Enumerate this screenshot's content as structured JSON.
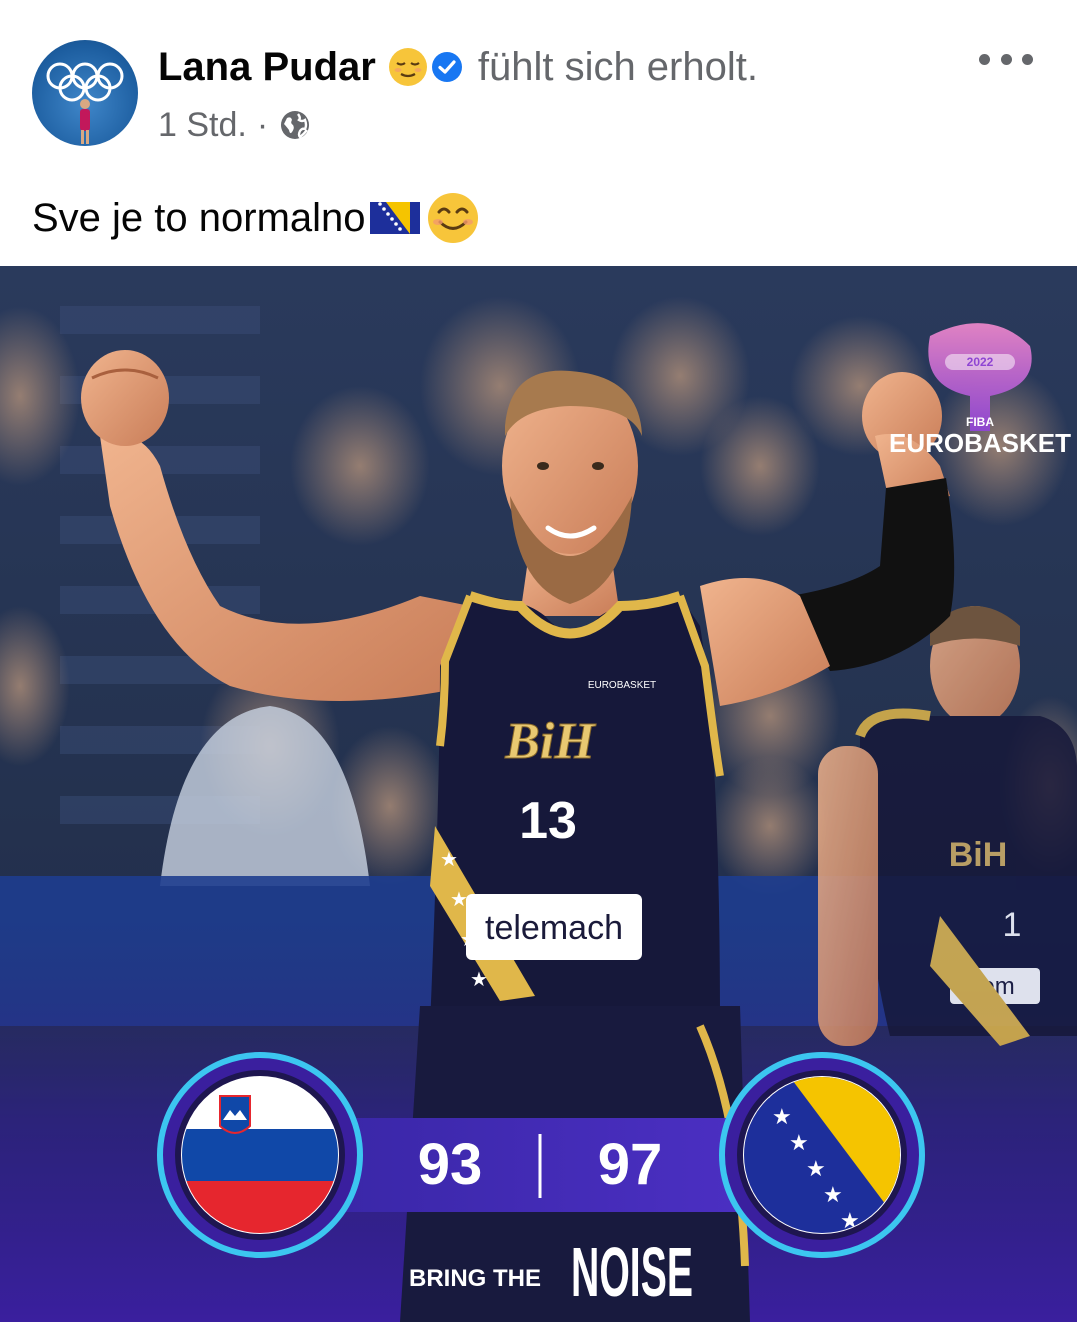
{
  "post": {
    "author": "Lana Pudar",
    "feeling": "fühlt sich erholt.",
    "timestamp": "1 Std.",
    "separator": "·",
    "text": "Sve je to normalno",
    "text_emojis": [
      "flag-bosnia-emoji",
      "smiling-face-emoji"
    ]
  },
  "image": {
    "brand": {
      "top": "FIBA",
      "name": "EUROBASKET",
      "year": "2022"
    },
    "jersey": {
      "team": "BiH",
      "number": "13",
      "sponsor": "telemach",
      "patch": "EUROBASKET"
    },
    "jersey_back": {
      "team": "BiH",
      "number": "1",
      "sponsor": "telem"
    },
    "scoreboard": {
      "home_score": "93",
      "away_score": "97",
      "home_team_flag": "slovenia-flag",
      "away_team_flag": "bosnia-flag"
    },
    "slogan": {
      "prefix": "BRING THE",
      "word": "NOISE"
    }
  },
  "colors": {
    "text_primary": "#050505",
    "text_secondary": "#65676b",
    "verified_blue": "#1877f2",
    "jersey_navy": "#16183a",
    "jersey_gold": "#e0b74a",
    "scoreboard_purple": "#3a1f9e"
  }
}
